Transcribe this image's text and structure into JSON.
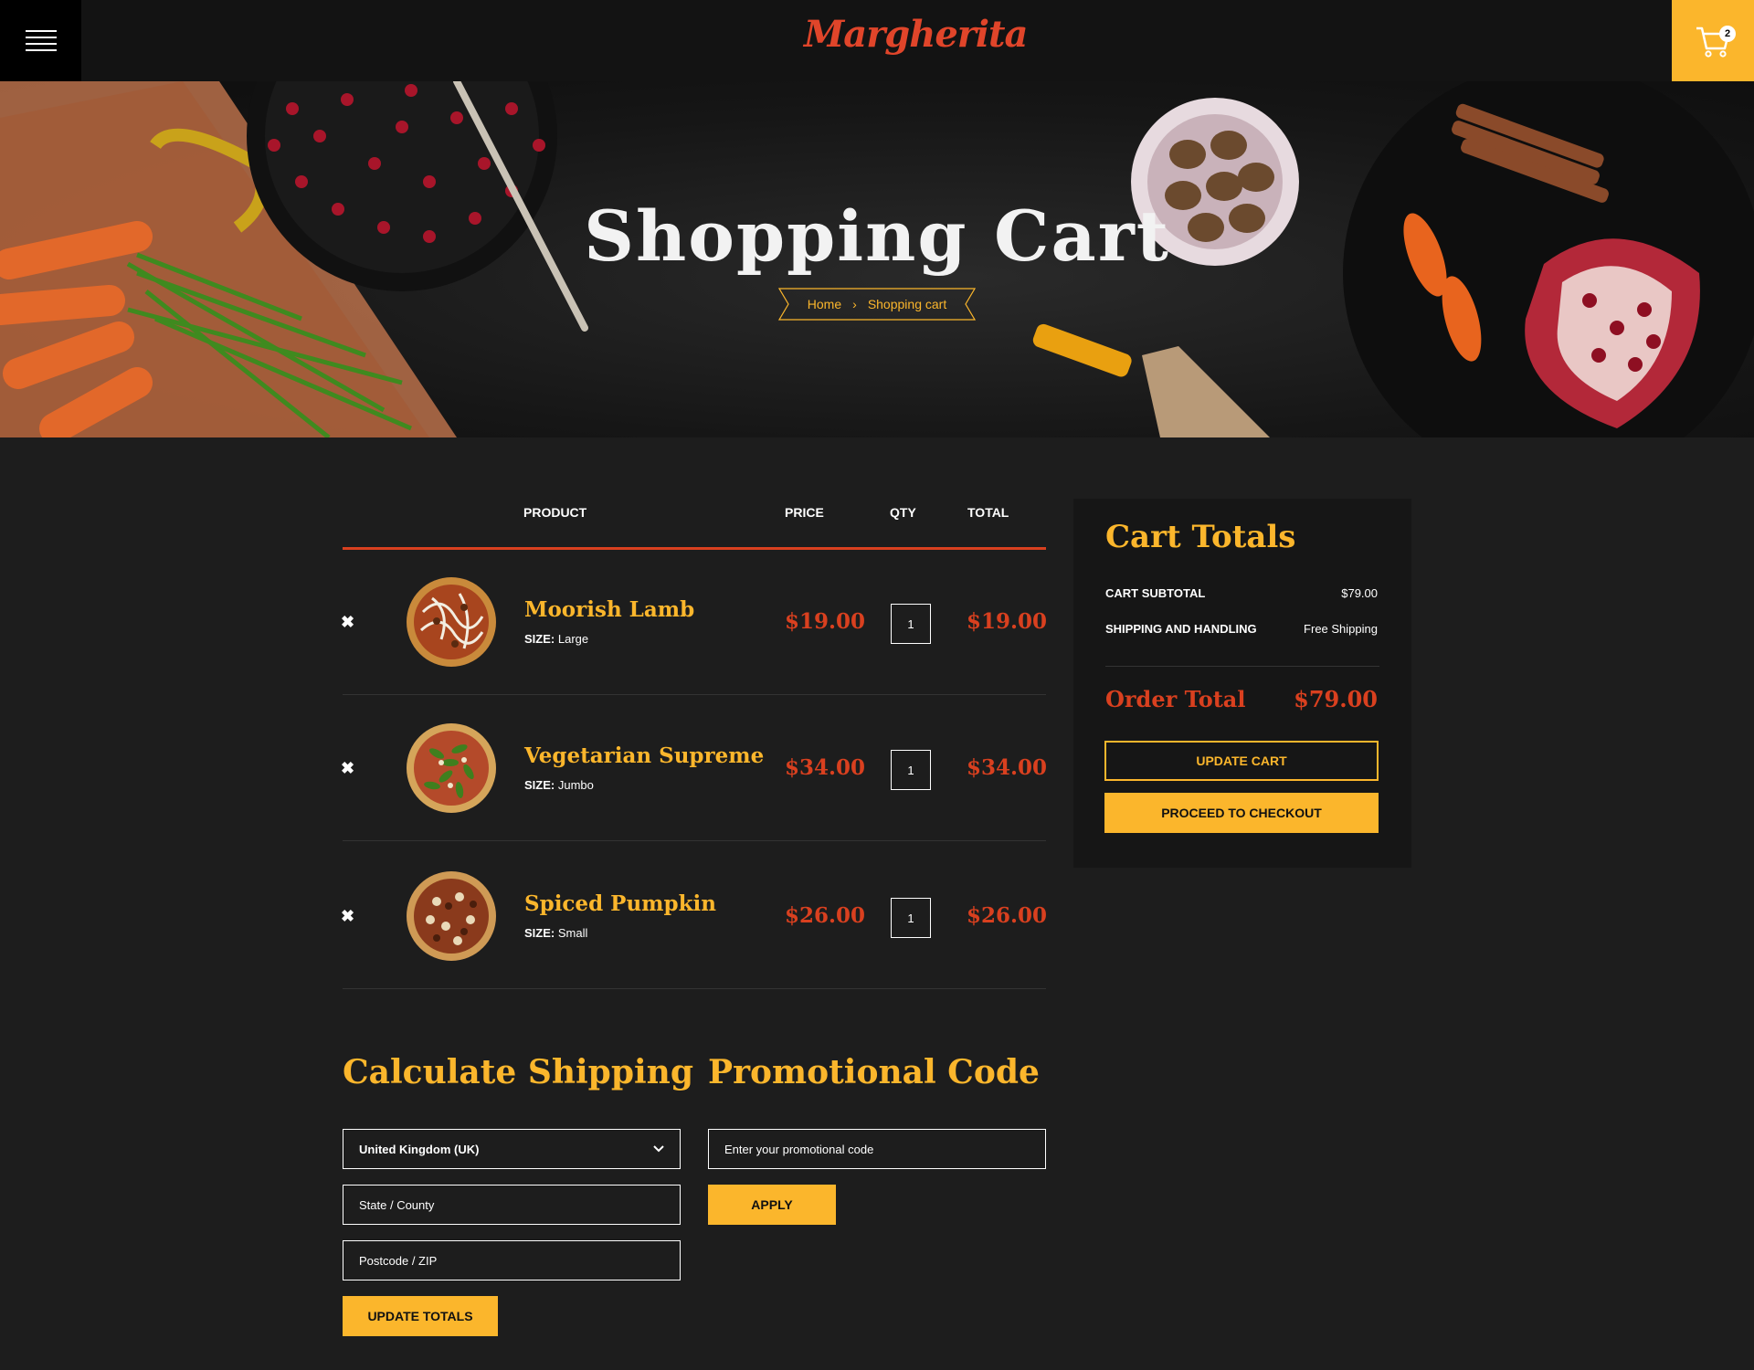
{
  "header": {
    "logo_text": "Margherita",
    "cart_count": "2"
  },
  "hero": {
    "title": "Shopping Cart",
    "breadcrumb": {
      "home": "Home",
      "separator": "›",
      "current": "Shopping cart"
    }
  },
  "table": {
    "headers": {
      "product": "PRODUCT",
      "price": "PRICE",
      "qty": "QTY",
      "total": "TOTAL"
    },
    "size_label": "SIZE:",
    "items": [
      {
        "name": "Moorish Lamb",
        "size": "Large",
        "price": "$19.00",
        "qty": "1",
        "total": "$19.00"
      },
      {
        "name": "Vegetarian Supreme",
        "size": "Jumbo",
        "price": "$34.00",
        "qty": "1",
        "total": "$34.00"
      },
      {
        "name": "Spiced Pumpkin",
        "size": "Small",
        "price": "$26.00",
        "qty": "1",
        "total": "$26.00"
      }
    ]
  },
  "totals": {
    "title": "Cart Totals",
    "subtotal_label": "CART SUBTOTAL",
    "subtotal_value": "$79.00",
    "shipping_label": "SHIPPING AND HANDLING",
    "shipping_value": "Free Shipping",
    "order_total_label": "Order Total",
    "order_total_value": "$79.00",
    "update_cart": "UPDATE CART",
    "checkout": "PROCEED TO CHECKOUT"
  },
  "shipping": {
    "title": "Calculate Shipping",
    "country": "United Kingdom (UK)",
    "state_placeholder": "State / County",
    "postcode_placeholder": "Postcode / ZIP",
    "update_totals": "UPDATE TOTALS"
  },
  "promo": {
    "title": "Promotional Code",
    "placeholder": "Enter your promotional code",
    "apply": "APPLY"
  },
  "colors": {
    "accent_yellow": "#fbb62c",
    "accent_red": "#d9401f",
    "background": "#1d1d1d"
  }
}
